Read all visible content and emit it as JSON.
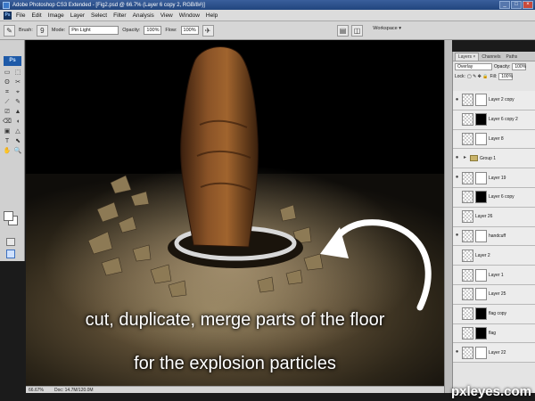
{
  "window": {
    "title": "Adobe Photoshop CS3 Extended - [Fig2.psd @ 66.7% (Layer 6 copy 2, RGB/8#)]",
    "buttons": [
      "_",
      "□",
      "×"
    ]
  },
  "menu": [
    "File",
    "Edit",
    "Image",
    "Layer",
    "Select",
    "Filter",
    "Analysis",
    "View",
    "Window",
    "Help"
  ],
  "options": {
    "brush_label": "Brush:",
    "brush_size": "9",
    "mode_label": "Mode:",
    "mode_value": "Pin Light",
    "opacity_label": "Opacity:",
    "opacity_value": "100%",
    "flow_label": "Flow:",
    "flow_value": "100%",
    "workspace_label": "Workspace ▾"
  },
  "tools": {
    "badge": "Ps",
    "items": [
      "▭",
      "⬚",
      "ʘ",
      "✂",
      "⌗",
      "⌖",
      "⟋",
      "✎",
      "⎚",
      "▲",
      "⌫",
      "◖",
      "▣",
      "△",
      "T",
      "⬉",
      "✋",
      "🔍"
    ]
  },
  "canvas": {
    "caption_line1": "cut, duplicate, merge parts of the floor",
    "caption_line2": "for the explosion particles"
  },
  "status": {
    "zoom": "66.67%",
    "doc": "Doc: 14.7M/120.0M"
  },
  "layers_panel": {
    "tabs": [
      "Layers ×",
      "Channels",
      "Paths"
    ],
    "blend_mode": "Overlay",
    "opacity_label": "Opacity:",
    "opacity_value": "100%",
    "lock_label": "Lock:",
    "fill_label": "Fill:",
    "fill_value": "100%",
    "layers": [
      {
        "name": "Layer 2 copy",
        "eye": true,
        "mask": "white"
      },
      {
        "name": "Layer 6 copy 2",
        "eye": false,
        "mask": "black"
      },
      {
        "name": "Layer 8",
        "eye": false,
        "mask": "white"
      },
      {
        "name": "Group 1",
        "eye": true,
        "mask": "folder"
      },
      {
        "name": "Layer 19",
        "eye": true,
        "mask": "white"
      },
      {
        "name": "Layer 6 copy",
        "eye": false,
        "mask": "black"
      },
      {
        "name": "Layer 26",
        "eye": false,
        "mask": "none"
      },
      {
        "name": "handcuff",
        "eye": true,
        "mask": "white"
      },
      {
        "name": "Layer 2",
        "eye": false,
        "mask": "none"
      },
      {
        "name": "Layer 1",
        "eye": false,
        "mask": "white"
      },
      {
        "name": "Layer 25",
        "eye": false,
        "mask": "white"
      },
      {
        "name": "flag copy",
        "eye": false,
        "mask": "black"
      },
      {
        "name": "flag",
        "eye": false,
        "mask": "black"
      },
      {
        "name": "Layer 22",
        "eye": true,
        "mask": "white"
      }
    ]
  },
  "watermark": "pxleyes.com"
}
